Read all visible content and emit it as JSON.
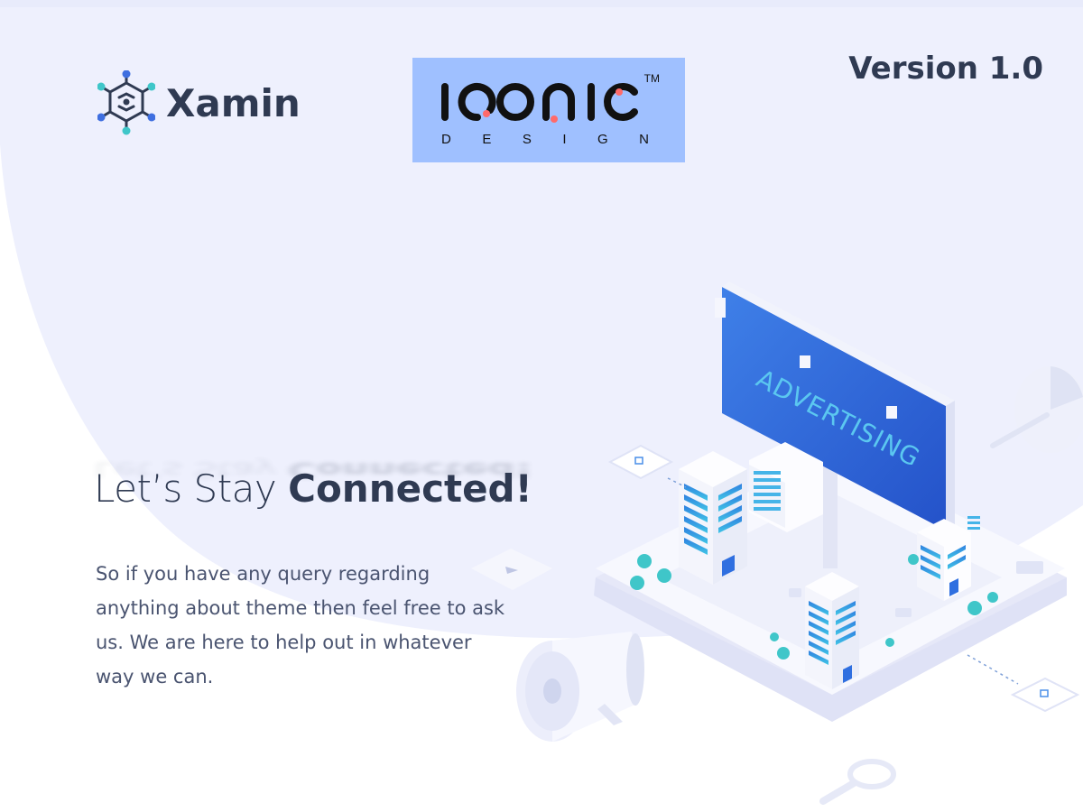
{
  "brand": {
    "xamin_name": "Xamin",
    "iqonic_name": "IQONIC",
    "iqonic_sub": [
      "D",
      "E",
      "S",
      "I",
      "G",
      "N"
    ],
    "iqonic_tm": "TM"
  },
  "version_label": "Version 1.0",
  "headline": {
    "light": "Let’s Stay ",
    "bold": "Connected!"
  },
  "body": "So if you have any query regarding anything about theme then feel free to ask us. We are here to help out in whatever way we can.",
  "billboard_text": "ADVERTISING",
  "colors": {
    "background_blob": "#eef0fd",
    "text_dark": "#2f3a52",
    "text_body": "#4a5470",
    "accent_blue": "#3f6fe0",
    "iqonic_bg": "#9fc0ff",
    "teal": "#3fc6c9"
  }
}
